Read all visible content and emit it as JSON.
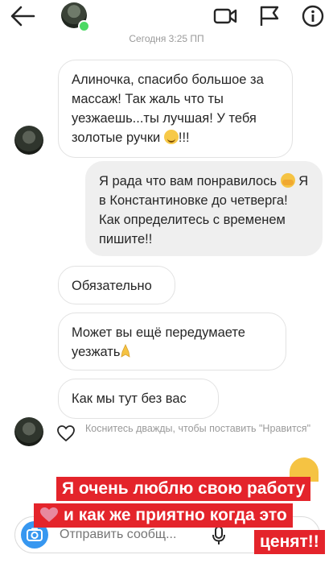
{
  "header": {
    "back_icon": "arrow-left-icon",
    "video_icon": "video-camera-icon",
    "flag_icon": "flag-icon",
    "info_icon": "info-icon",
    "online_color": "#4cd964"
  },
  "conversation": {
    "timestamp": "Сегодня 3:25 ПП",
    "messages": [
      {
        "direction": "incoming",
        "text": "Алиночка, спасибо большое за массаж! Так жаль что ты уезжаешь...ты лучшая! У тебя золотые ручки",
        "emoji": "smiling-face",
        "tail": "!!!"
      },
      {
        "direction": "outgoing",
        "text_before": "Я рада что вам понравилось",
        "emoji": "face-with-hand-over-mouth",
        "text_after": "Я в Константиновке до четверга! Как определитесь с временем пишите!!"
      },
      {
        "direction": "incoming",
        "text": "Обязательно"
      },
      {
        "direction": "incoming",
        "text": "Может вы ещё передумаете уезжать",
        "emoji": "folded-hands"
      },
      {
        "direction": "incoming",
        "text": "Как мы тут без вас"
      }
    ],
    "like_hint": "Коснитесь дважды, чтобы поставить \"Нравится\""
  },
  "composer": {
    "placeholder": "Отправить сообщ...",
    "camera_icon": "camera-icon",
    "mic_icon": "microphone-icon",
    "accent": "#3797f0"
  },
  "overlay_caption": {
    "line1": "Я очень люблю свою работу",
    "line2": "и как же приятно когда это",
    "line3": "ценят!!",
    "background": "#e4242b",
    "text_color": "#ffffff",
    "heart_icon": "heart-sticker-icon"
  }
}
